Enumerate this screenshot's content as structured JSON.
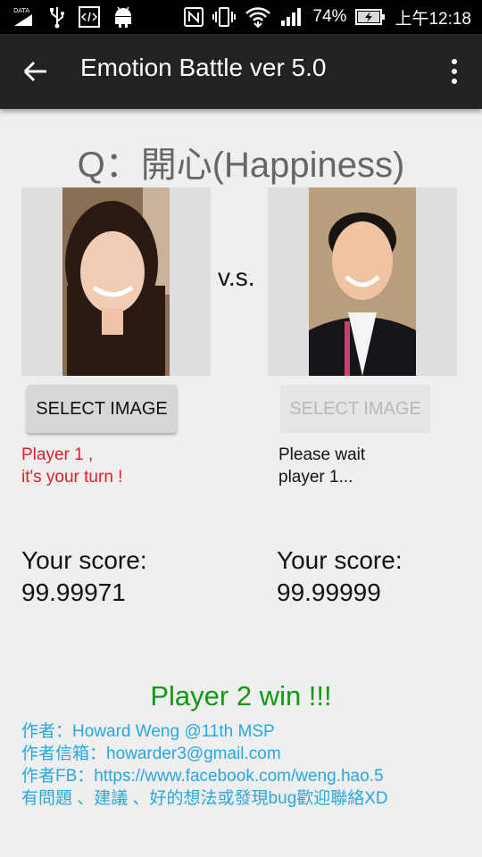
{
  "status_bar": {
    "data_label": "DATA",
    "battery": "74%",
    "time": "上午12:18",
    "icons": [
      "data-icon",
      "usb-icon",
      "code-icon",
      "android-icon",
      "nfc-icon",
      "vibrate-icon",
      "wifi-icon",
      "signal-icon",
      "battery-icon"
    ]
  },
  "app_bar": {
    "title": "Emotion Battle ver 5.0"
  },
  "question": "Q：開心(Happiness)",
  "vs": "v.s.",
  "player1": {
    "button": "SELECT IMAGE",
    "message_line1": "Player 1 ,",
    "message_line2": "it's your turn !",
    "score_label": "Your score:",
    "score": "99.99971"
  },
  "player2": {
    "button": "SELECT IMAGE",
    "message_line1": "Please wait",
    "message_line2": "player 1...",
    "score_label": "Your score:",
    "score": "99.99999"
  },
  "winner": "Player 2 win !!!",
  "author": {
    "line1": "作者：Howard Weng @11th MSP",
    "line2": "作者信箱：howarder3@gmail.com",
    "line3": "作者FB：https://www.facebook.com/weng.hao.5",
    "line4": "有問題 、建議 、好的想法或發現bug歡迎聯絡XD"
  },
  "colors": {
    "appbar": "#222222",
    "background": "#efefef",
    "player1_message": "#e02020",
    "winner": "#119911",
    "author_text": "#2aa6e0"
  }
}
